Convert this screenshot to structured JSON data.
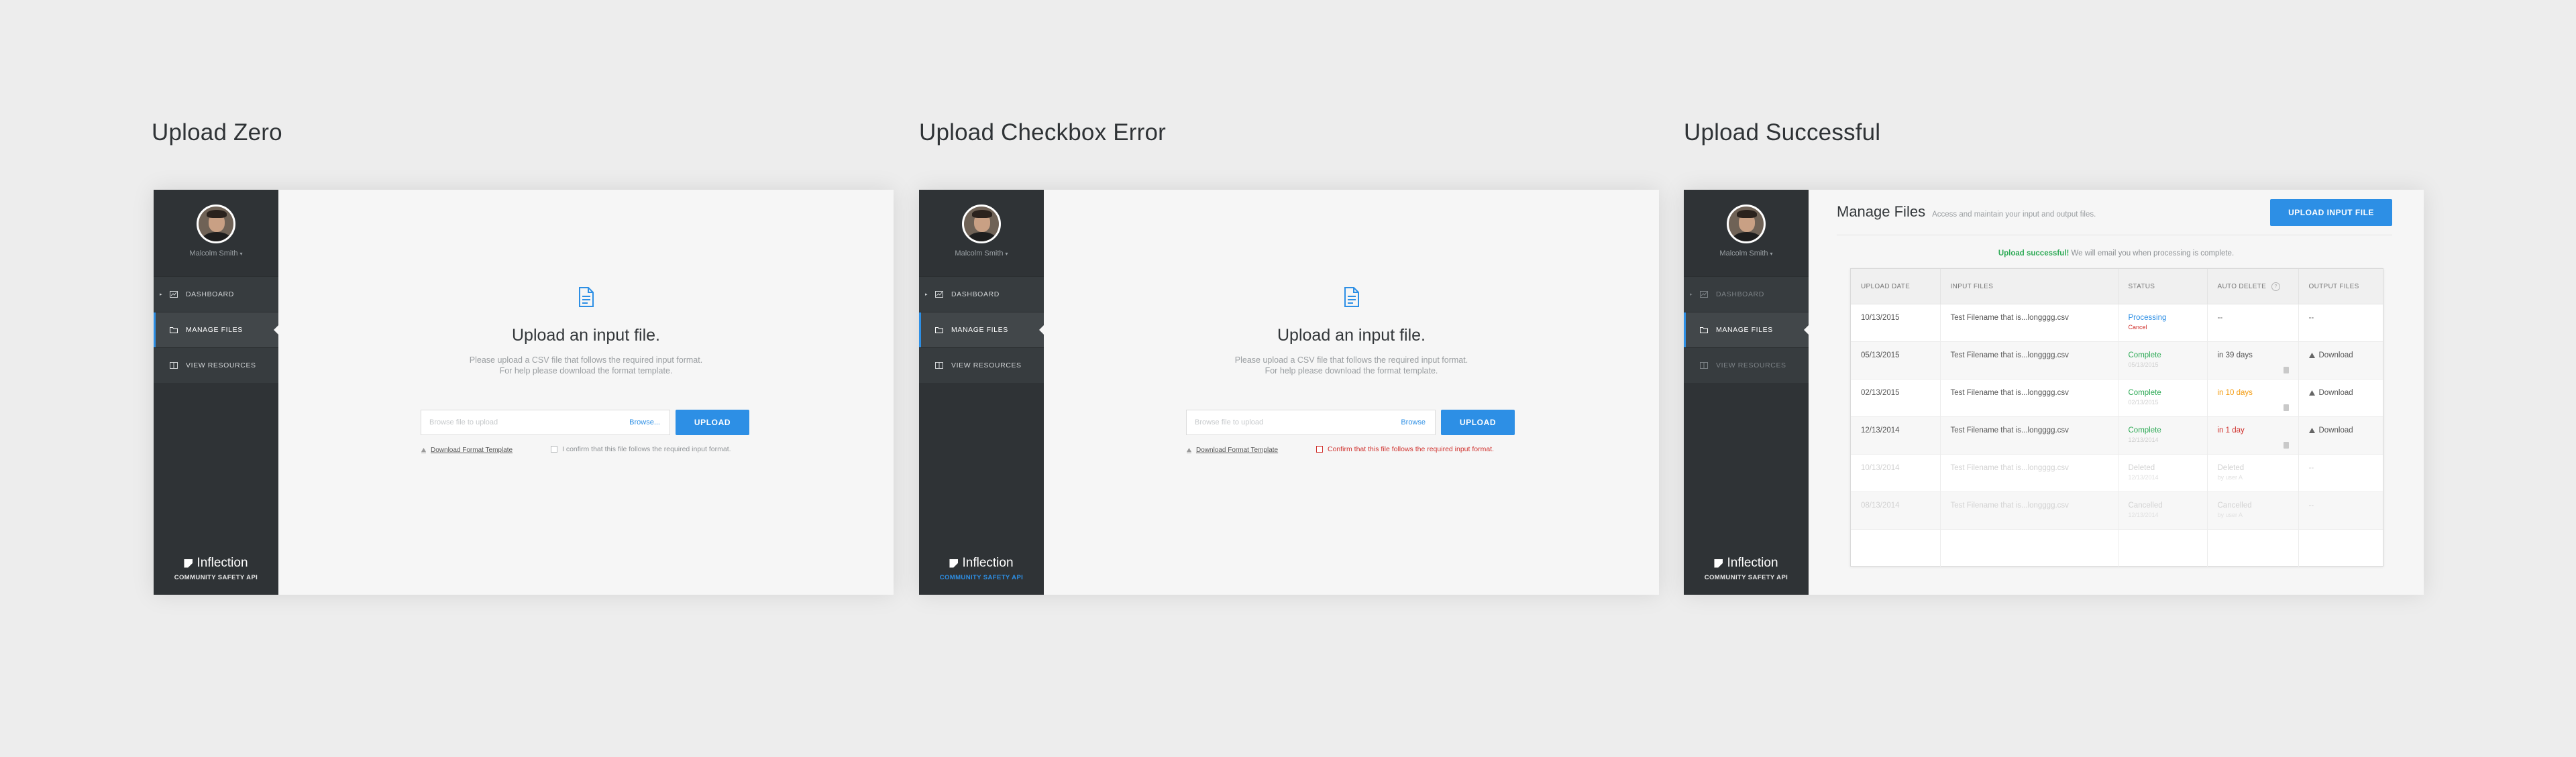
{
  "boards": [
    {
      "title": "Upload Zero",
      "user_name": "Malcolm Smith",
      "nav": [
        "DASHBOARD",
        "MANAGE FILES",
        "VIEW RESOURCES"
      ],
      "brand": "Inflection",
      "tagline": "COMMUNITY SAFETY API",
      "upload_title": "Upload an input file.",
      "upload_desc_1": "Please upload a CSV file that follows the required input format.",
      "upload_desc_2": "For help please download the format template.",
      "choose_placeholder": "Browse file to upload",
      "browse_label": "Browse...",
      "upload_button": "UPLOAD",
      "download_template": "Download Format Template",
      "confirm_label": "I confirm that this file follows the required input format."
    },
    {
      "title": "Upload Checkbox Error",
      "user_name": "Malcolm Smith",
      "nav": [
        "DASHBOARD",
        "MANAGE FILES",
        "VIEW RESOURCES"
      ],
      "brand": "Inflection",
      "tagline": "COMMUNITY SAFETY API",
      "upload_title": "Upload an input file.",
      "upload_desc_1": "Please upload a CSV file that follows the required input format.",
      "upload_desc_2": "For help please download the format template.",
      "choose_placeholder": "Browse file to upload",
      "browse_label": "Browse",
      "upload_button": "UPLOAD",
      "download_template": "Download Format Template",
      "confirm_label": "Confirm that this file follows the required input format."
    },
    {
      "title": "Upload Successful",
      "user_name": "Malcolm Smith",
      "nav": [
        "DASHBOARD",
        "MANAGE FILES",
        "VIEW RESOURCES"
      ],
      "brand": "Inflection",
      "tagline": "COMMUNITY SAFETY API",
      "page_title": "Manage Files",
      "page_subtitle": "Access and maintain your input and output files.",
      "upload_button": "UPLOAD INPUT FILE",
      "success_strong": "Upload successful!",
      "success_rest": "We will email you when processing is complete.",
      "columns": [
        "UPLOAD DATE",
        "INPUT FILES",
        "STATUS",
        "AUTO DELETE",
        "OUTPUT FILES"
      ],
      "rows": [
        {
          "date": "10/13/2015",
          "file": "Test Filename that is...longggg.csv",
          "status": "Processing",
          "status_sub": "Cancel",
          "auto": "--",
          "auto_sub": "",
          "output": "--"
        },
        {
          "date": "05/13/2015",
          "file": "Test Filename that is...longggg.csv",
          "status": "Complete",
          "status_sub": "05/13/2015",
          "auto": "in 39 days",
          "auto_sub": "",
          "output": "Download"
        },
        {
          "date": "02/13/2015",
          "file": "Test Filename that is...longggg.csv",
          "status": "Complete",
          "status_sub": "02/13/2015",
          "auto": "in 10 days",
          "auto_sub": "",
          "output": "Download"
        },
        {
          "date": "12/13/2014",
          "file": "Test Filename that is...longggg.csv",
          "status": "Complete",
          "status_sub": "12/13/2014",
          "auto": "in 1 day",
          "auto_sub": "",
          "output": "Download"
        },
        {
          "date": "10/13/2014",
          "file": "Test Filename that is...longggg.csv",
          "status": "Deleted",
          "status_sub": "12/13/2014",
          "auto": "Deleted",
          "auto_sub": "by user A",
          "output": "--"
        },
        {
          "date": "08/13/2014",
          "file": "Test Filename that is...longggg.csv",
          "status": "Cancelled",
          "status_sub": "12/13/2014",
          "auto": "Cancelled",
          "auto_sub": "by user A",
          "output": "--"
        }
      ]
    }
  ],
  "colors": {
    "accent": "#2d8fe5",
    "sidebar": "#2f3336",
    "success": "#2eaa56",
    "warning": "#f39c12",
    "error": "#d0312d"
  },
  "icons": [
    "file-icon",
    "dashboard-icon",
    "folder-icon",
    "book-icon",
    "download-icon",
    "trash-icon",
    "help-icon"
  ]
}
